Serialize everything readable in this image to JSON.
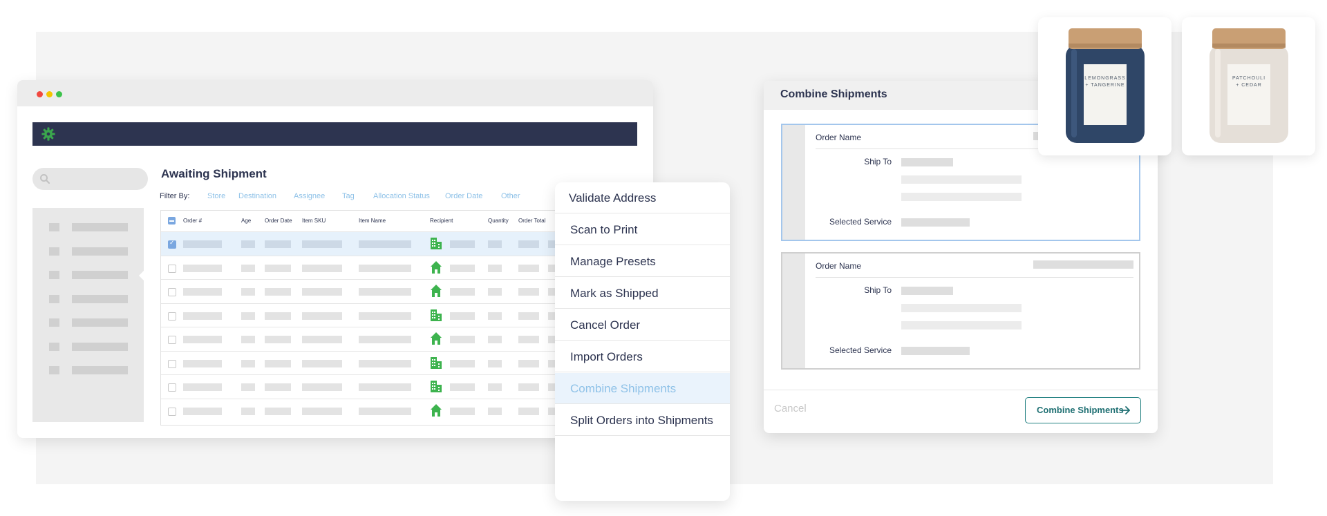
{
  "app": {
    "page_title": "Awaiting Shipment",
    "filter_label": "Filter By:",
    "filters": [
      "Store",
      "Destination",
      "Assignee",
      "Tag",
      "Allocation Status",
      "Order Date",
      "Other"
    ],
    "columns": [
      "Order #",
      "Age",
      "Order Date",
      "Item SKU",
      "Item Name",
      "Recipient",
      "Quantity",
      "Order Total"
    ],
    "rows": [
      {
        "selected": true,
        "recipient_icon": "building-icon"
      },
      {
        "selected": false,
        "recipient_icon": "house-icon"
      },
      {
        "selected": false,
        "recipient_icon": "house-icon"
      },
      {
        "selected": false,
        "recipient_icon": "building-icon"
      },
      {
        "selected": false,
        "recipient_icon": "house-icon"
      },
      {
        "selected": false,
        "recipient_icon": "building-icon"
      },
      {
        "selected": false,
        "recipient_icon": "building-icon"
      },
      {
        "selected": false,
        "recipient_icon": "house-icon"
      }
    ],
    "colors": {
      "header": "#2d3450",
      "logo": "#3aa64d",
      "recipient_icon": "#3db34e",
      "filter_link": "#8fc2e8",
      "selection": "#7aa7e0"
    }
  },
  "menu": {
    "items": [
      {
        "label": "Validate Address",
        "active": false
      },
      {
        "label": "Scan to Print",
        "active": false
      },
      {
        "label": "Manage Presets",
        "active": false
      },
      {
        "label": "Mark as Shipped",
        "active": false
      },
      {
        "label": "Cancel Order",
        "active": false
      },
      {
        "label": "Import Orders",
        "active": false
      },
      {
        "label": "Combine Shipments",
        "active": true
      },
      {
        "label": "Split Orders into Shipments",
        "active": false
      }
    ]
  },
  "dialog": {
    "title": "Combine Shipments",
    "cards": [
      {
        "order_name_label": "Order Name",
        "ship_to_label": "Ship To",
        "service_label": "Selected Service",
        "highlighted": true
      },
      {
        "order_name_label": "Order Name",
        "ship_to_label": "Ship To",
        "service_label": "Selected Service",
        "highlighted": false
      }
    ],
    "cancel_label": "Cancel",
    "combine_label": "Combine Shipments",
    "colors": {
      "accent": "#1f7f80",
      "highlight_border": "#a3c6ec"
    }
  },
  "products": [
    {
      "label_lines": [
        "LEMONGRASS",
        "+ TANGERINE"
      ],
      "jar_color": "#2f4667"
    },
    {
      "label_lines": [
        "PATCHOULI",
        "+ CEDAR"
      ],
      "jar_color": "#e5dfd8"
    }
  ]
}
